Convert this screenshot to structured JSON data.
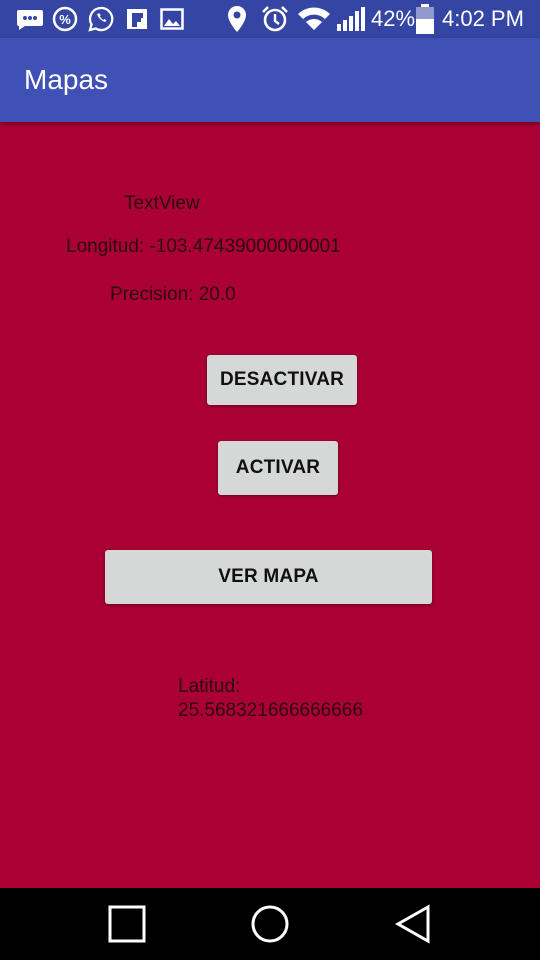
{
  "status_bar": {
    "icons": [
      "chat-icon",
      "percent-badge-icon",
      "whatsapp-icon",
      "flipboard-icon",
      "gallery-icon",
      "location-icon",
      "alarm-icon",
      "wifi-icon",
      "signal-icon",
      "battery-icon"
    ],
    "battery_level": "42%",
    "time": "4:02 PM"
  },
  "app_bar": {
    "title": "Mapas"
  },
  "main": {
    "textview": "TextView",
    "longitud": "Longitud: -103.47439000000001",
    "precision": "Precision: 20.0",
    "btn_desactivar": "DESACTIVAR",
    "btn_activar": "ACTIVAR",
    "btn_ver_mapa": "VER MAPA",
    "latitud_label": "Latitud:",
    "latitud_value": "25.568321666666666"
  },
  "nav_bar": {
    "icons": [
      "recents-icon",
      "home-icon",
      "back-icon"
    ]
  },
  "colors": {
    "status_bar": "#3545a3",
    "app_bar": "#3f51b5",
    "background": "#ab0033",
    "button": "#d6d7d7"
  }
}
